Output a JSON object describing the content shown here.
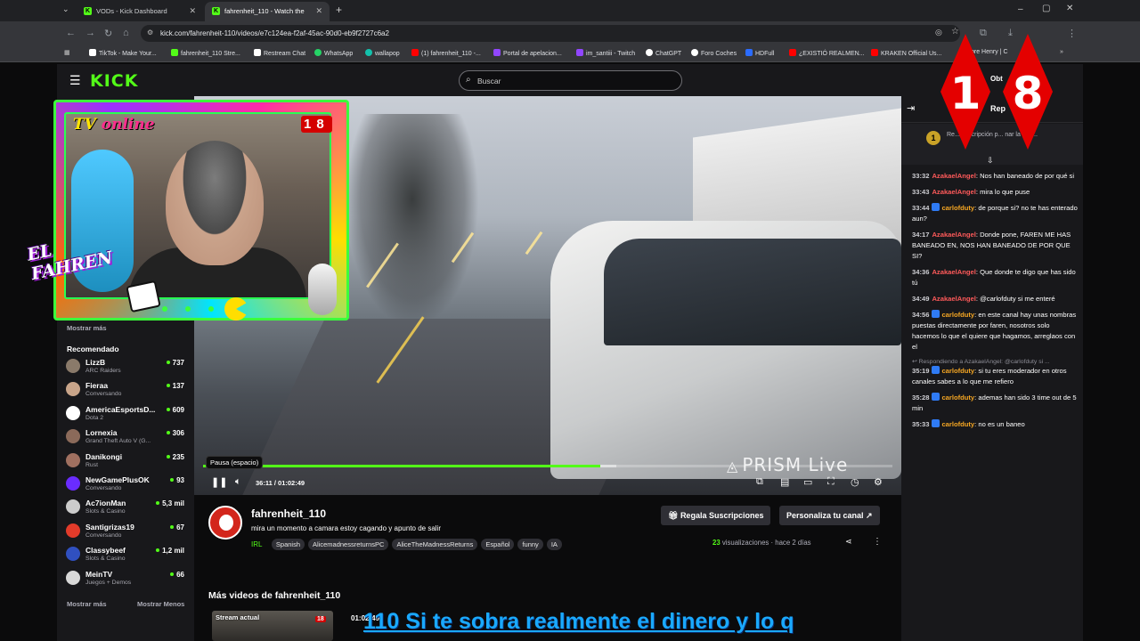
{
  "browser": {
    "tabs": [
      {
        "label": "VODs - Kick Dashboard",
        "active": false
      },
      {
        "label": "fahrenheit_110 - Watch the",
        "active": true
      }
    ],
    "url": "kick.com/fahrenheit-110/videos/e7c124ea-f2af-45ac-90d0-eb9f2727c6a2",
    "bookmarks": [
      {
        "label": "TikTok - Make Your...",
        "color": "#ffffff"
      },
      {
        "label": "fahrenheit_110 Stre...",
        "color": "#53fc18"
      },
      {
        "label": "Restream Chat",
        "color": "#ffffff"
      },
      {
        "label": "WhatsApp",
        "color": "#25d366"
      },
      {
        "label": "wallapop",
        "color": "#13c1ac"
      },
      {
        "label": "(1) fahrenheit_110 -...",
        "color": "#ff0000"
      },
      {
        "label": "Portal de apelacion...",
        "color": "#9146ff"
      },
      {
        "label": "im_santiii - Twitch",
        "color": "#9146ff"
      },
      {
        "label": "ChatGPT",
        "color": "#ffffff"
      },
      {
        "label": "Foro Coches",
        "color": "#ffffff"
      },
      {
        "label": "HDFull",
        "color": "#2b6cff"
      },
      {
        "label": "¿EXISTIÓ REALMEN...",
        "color": "#ff0000"
      },
      {
        "label": "KRAKEN Official Us...",
        "color": "#ff0000"
      },
      {
        "label": "ore Henry | C",
        "color": "#ffffff"
      }
    ]
  },
  "kick": {
    "logo": "KICK",
    "search_placeholder": "Buscar",
    "obtain_label": "Obt"
  },
  "sidebar": {
    "show_more_top": "Mostrar más",
    "recommended_title": "Recomendado",
    "channels": [
      {
        "name": "LizzB",
        "game": "ARC Raiders",
        "viewers": "737",
        "color": "#8a7a6a"
      },
      {
        "name": "Fieraa",
        "game": "Conversando",
        "viewers": "137",
        "color": "#c9a58a"
      },
      {
        "name": "AmericaEsportsD...",
        "game": "Dota 2",
        "viewers": "609",
        "color": "#ffffff"
      },
      {
        "name": "Lornexia",
        "game": "Grand Theft Auto V (G...",
        "viewers": "306",
        "color": "#8b6a5a"
      },
      {
        "name": "Danikongi",
        "game": "Rust",
        "viewers": "235",
        "color": "#a07060"
      },
      {
        "name": "NewGamePlusOK",
        "game": "Conversando",
        "viewers": "93",
        "color": "#6a2cff"
      },
      {
        "name": "Ac7ionMan",
        "game": "Slots & Casino",
        "viewers": "5,3 mil",
        "color": "#cccccc"
      },
      {
        "name": "Santigrizas19",
        "game": "Conversando",
        "viewers": "67",
        "color": "#e23b2a"
      },
      {
        "name": "Classybeef",
        "game": "Slots & Casino",
        "viewers": "1,2 mil",
        "color": "#3050c0"
      },
      {
        "name": "MeinTV",
        "game": "Juegos + Demos",
        "viewers": "66",
        "color": "#d8d8d8"
      }
    ],
    "show_more_bottom": "Mostrar más",
    "show_less_bottom": "Mostrar Menos"
  },
  "overlay": {
    "tv_a": "TV",
    "tv_b": " online",
    "mini_badge": "18",
    "el_fahren_line1": "EL",
    "el_fahren_line2": "FAHREN"
  },
  "player": {
    "watermark": "PRISM Live",
    "tooltip": "Pausa (espacio)",
    "time": "36:11 / 01:02:49",
    "progress_fraction": 0.576,
    "buffered_fraction": 0.6
  },
  "stream": {
    "channel": "fahrenheit_110",
    "title": "mira un momento a camara estoy cagando y apunto de salir",
    "category": "IRL",
    "tags": [
      "Spanish",
      "AlicemadnessreturnsPC",
      "AliceTheMadnessReturns",
      "Español",
      "funny",
      "IA"
    ],
    "gift_button": "Regala Suscripciones",
    "customize_button": "Personaliza tu canal",
    "views_count": "23",
    "views_label": "visualizaciones",
    "posted": "hace 2 días",
    "more_videos_title": "Más videos de fahrenheit_110",
    "thumb_label": "Stream actual",
    "thumb_badge": "18",
    "video_duration": "01:02:49",
    "ticker_text": "110 Si te sobra realmente el dinero y lo q"
  },
  "chat": {
    "title": "Rep",
    "pinned_badge": "1",
    "pinned_text": "Re... suscripción p... nar la pos...",
    "messages": [
      {
        "time": "33:32",
        "user": "AzakaelAngel",
        "color": "#ff5a5a",
        "badge": false,
        "text": "Nos han baneado de por qué si"
      },
      {
        "time": "33:43",
        "user": "AzakaelAngel",
        "color": "#ff5a5a",
        "badge": false,
        "text": "mira lo que puse"
      },
      {
        "time": "33:44",
        "user": "carlofduty",
        "color": "#f5a623",
        "badge": true,
        "text": "de porque si? no te has enterado aun?"
      },
      {
        "time": "34:17",
        "user": "AzakaelAngel",
        "color": "#ff5a5a",
        "badge": false,
        "text": "Donde pone, FAREN ME HAS BANEADO EN, NOS HAN BANEADO DE POR QUE SI?"
      },
      {
        "time": "34:36",
        "user": "AzakaelAngel",
        "color": "#ff5a5a",
        "badge": false,
        "text": "Que donde te digo que has sido tú"
      },
      {
        "time": "34:49",
        "user": "AzakaelAngel",
        "color": "#ff5a5a",
        "badge": false,
        "text": "@carlofduty si me enteré"
      },
      {
        "time": "34:56",
        "user": "carlofduty",
        "color": "#f5a623",
        "badge": true,
        "text": "en este canal hay unas nombras puestas directamente por faren, nosotros solo hacemos lo que el quiere que hagamos, arreglaos con el"
      },
      {
        "time": "35:19",
        "user": "carlofduty",
        "color": "#f5a623",
        "badge": true,
        "reply": "Respondiendo a AzakaelAngel: @carlofduty si ...",
        "text": "si tu eres moderador en otros canales sabes a lo que me refiero"
      },
      {
        "time": "35:28",
        "user": "carlofduty",
        "color": "#f5a623",
        "badge": true,
        "text": "ademas han sido 3 time out de 5 min"
      },
      {
        "time": "35:33",
        "user": "carlofduty",
        "color": "#f5a623",
        "badge": true,
        "text": "no es un baneo"
      }
    ]
  },
  "rating_badge": {
    "digit1": "1",
    "digit2": "8"
  }
}
